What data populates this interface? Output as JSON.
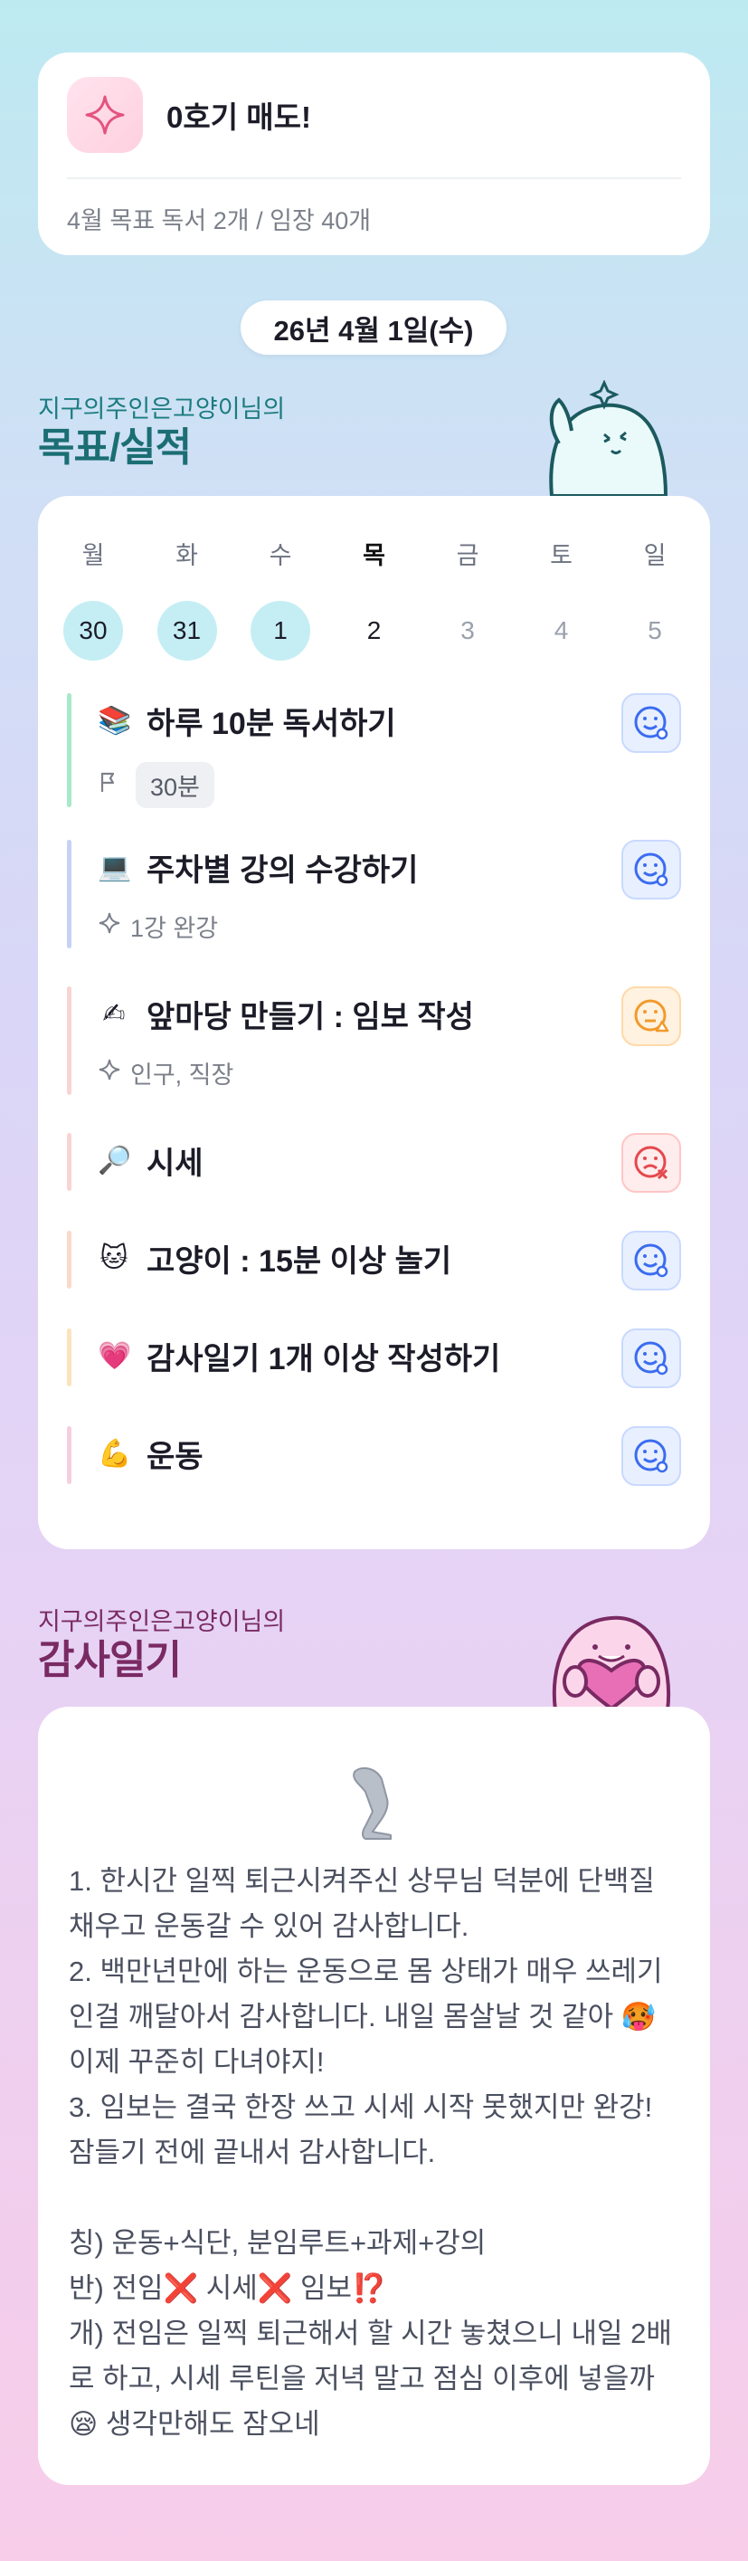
{
  "goal": {
    "title": "0호기 매도!",
    "subtitle": "4월 목표  독서 2개 / 임장 40개"
  },
  "date_pill": "26년 4월 1일(수)",
  "habits_section": {
    "owner": "지구의주인은고양이님의",
    "title": "목표/실적"
  },
  "week": [
    {
      "name": "월",
      "num": "30",
      "state": "done"
    },
    {
      "name": "화",
      "num": "31",
      "state": "done"
    },
    {
      "name": "수",
      "num": "1",
      "state": "done"
    },
    {
      "name": "목",
      "num": "2",
      "state": "today"
    },
    {
      "name": "금",
      "num": "3",
      "state": "future"
    },
    {
      "name": "토",
      "num": "4",
      "state": "future"
    },
    {
      "name": "일",
      "num": "5",
      "state": "future"
    }
  ],
  "habits": [
    {
      "emoji": "📚",
      "title": "하루 10분 독서하기",
      "meta_icon": "flag-icon",
      "meta": "30분",
      "status": "happy",
      "bar_color": "#a7e9c9"
    },
    {
      "emoji": "💻",
      "title": "주차별 강의 수강하기",
      "meta_icon": "sparkle-icon",
      "meta": "1강 완강",
      "status": "happy",
      "bar_color": "#c6d2f5"
    },
    {
      "emoji": "✍",
      "title": "앞마당 만들기 : 임보 작성",
      "meta_icon": "sparkle-icon",
      "meta": "인구, 직장",
      "status": "warning",
      "bar_color": "#f9d4d4"
    },
    {
      "emoji": "🔎",
      "title": "시세",
      "meta": "",
      "status": "fail",
      "bar_color": "#f9d4d4"
    },
    {
      "emoji": "🐱",
      "title": "고양이 : 15분 이상 놀기",
      "meta": "",
      "status": "happy",
      "bar_color": "#fbd9c9"
    },
    {
      "emoji": "💗",
      "title": "감사일기 1개 이상 작성하기",
      "meta": "",
      "status": "happy",
      "bar_color": "#fbe4bd"
    },
    {
      "emoji": "💪",
      "title": "운동",
      "meta": "",
      "status": "happy",
      "bar_color": "#f5cfe0"
    }
  ],
  "gratitude_section": {
    "owner": "지구의주인은고양이님의",
    "title": "감사일기"
  },
  "gratitude": {
    "body": "1. 한시간 일찍 퇴근시켜주신 상무님 덕분에 단백질 채우고 운동갈 수 있어 감사합니다.\n2. 백만년만에 하는 운동으로 몸 상태가 매우 쓰레기인걸 깨달아서 감사합니다. 내일 몸살날 것 같아 🥵 이제 꾸준히 다녀야지!\n3. 임보는 결국 한장 쓰고 시세 시작 못했지만 완강! 잠들기 전에 끝내서 감사합니다.\n\n칭) 운동+식단, 분임루트+과제+강의\n반) 전임❌ 시세❌ 임보⁉️\n개) 전임은 일찍 퇴근해서 할 시간 놓쳤으니 내일 2배로 하고, 시세 루틴을 저녁 말고 점심 이후에 넣을까😪 생각만해도 잠오네"
  },
  "colors": {
    "accent_teal": "#1b6e73",
    "accent_purple": "#7a2a63",
    "happy_blue": "#3b6cf0",
    "warn_orange": "#f29a2e",
    "fail_red": "#e5484d"
  }
}
